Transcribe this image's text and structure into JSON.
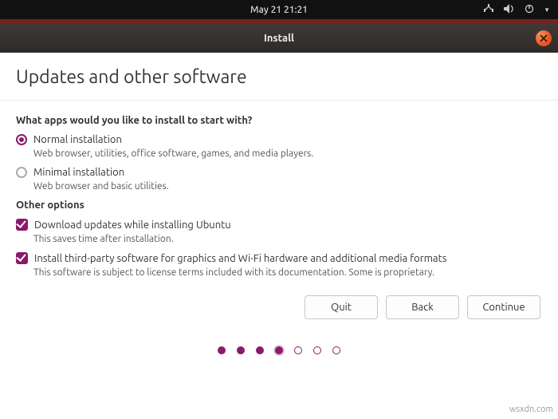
{
  "panel": {
    "clock": "May 21  21:21"
  },
  "titlebar": {
    "title": "Install"
  },
  "page": {
    "heading": "Updates and other software",
    "question": "What apps would you like to install to start with?",
    "radios": [
      {
        "label": "Normal installation",
        "desc": "Web browser, utilities, office software, games, and media players.",
        "selected": true
      },
      {
        "label": "Minimal installation",
        "desc": "Web browser and basic utilities.",
        "selected": false
      }
    ],
    "other_label": "Other options",
    "checks": [
      {
        "label": "Download updates while installing Ubuntu",
        "desc": "This saves time after installation."
      },
      {
        "label": "Install third-party software for graphics and Wi-Fi hardware and additional media formats",
        "desc": "This software is subject to license terms included with its documentation. Some is proprietary."
      }
    ],
    "buttons": {
      "quit": "Quit",
      "back": "Back",
      "continue": "Continue"
    },
    "progress": {
      "current": 4,
      "total": 7
    }
  },
  "watermark": "wsxdn.com"
}
